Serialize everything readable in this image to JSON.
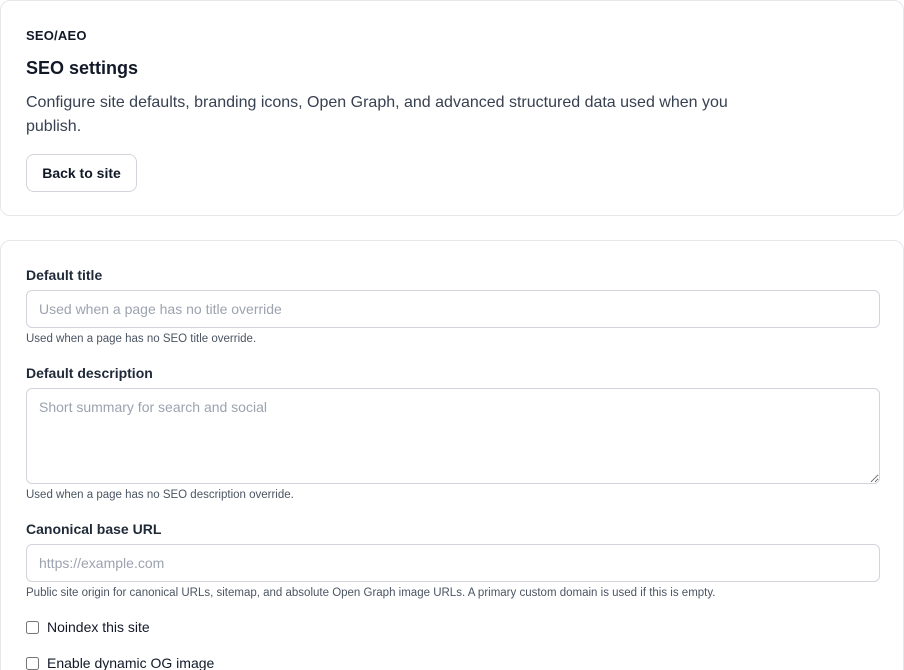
{
  "header": {
    "eyebrow": "SEO/AEO",
    "title": "SEO settings",
    "description": "Configure site defaults, branding icons, Open Graph, and advanced structured data used when you publish.",
    "back_label": "Back to site"
  },
  "form": {
    "default_title": {
      "label": "Default title",
      "placeholder": "Used when a page has no title override",
      "value": "",
      "help": "Used when a page has no SEO title override."
    },
    "default_description": {
      "label": "Default description",
      "placeholder": "Short summary for search and social",
      "value": "",
      "help": "Used when a page has no SEO description override."
    },
    "canonical_base_url": {
      "label": "Canonical base URL",
      "placeholder": "https://example.com",
      "value": "",
      "help": "Public site origin for canonical URLs, sitemap, and absolute Open Graph image URLs. A primary custom domain is used if this is empty."
    },
    "checkboxes": [
      {
        "label": "Noindex this site",
        "checked": false
      },
      {
        "label": "Enable dynamic OG image",
        "checked": false
      }
    ]
  }
}
